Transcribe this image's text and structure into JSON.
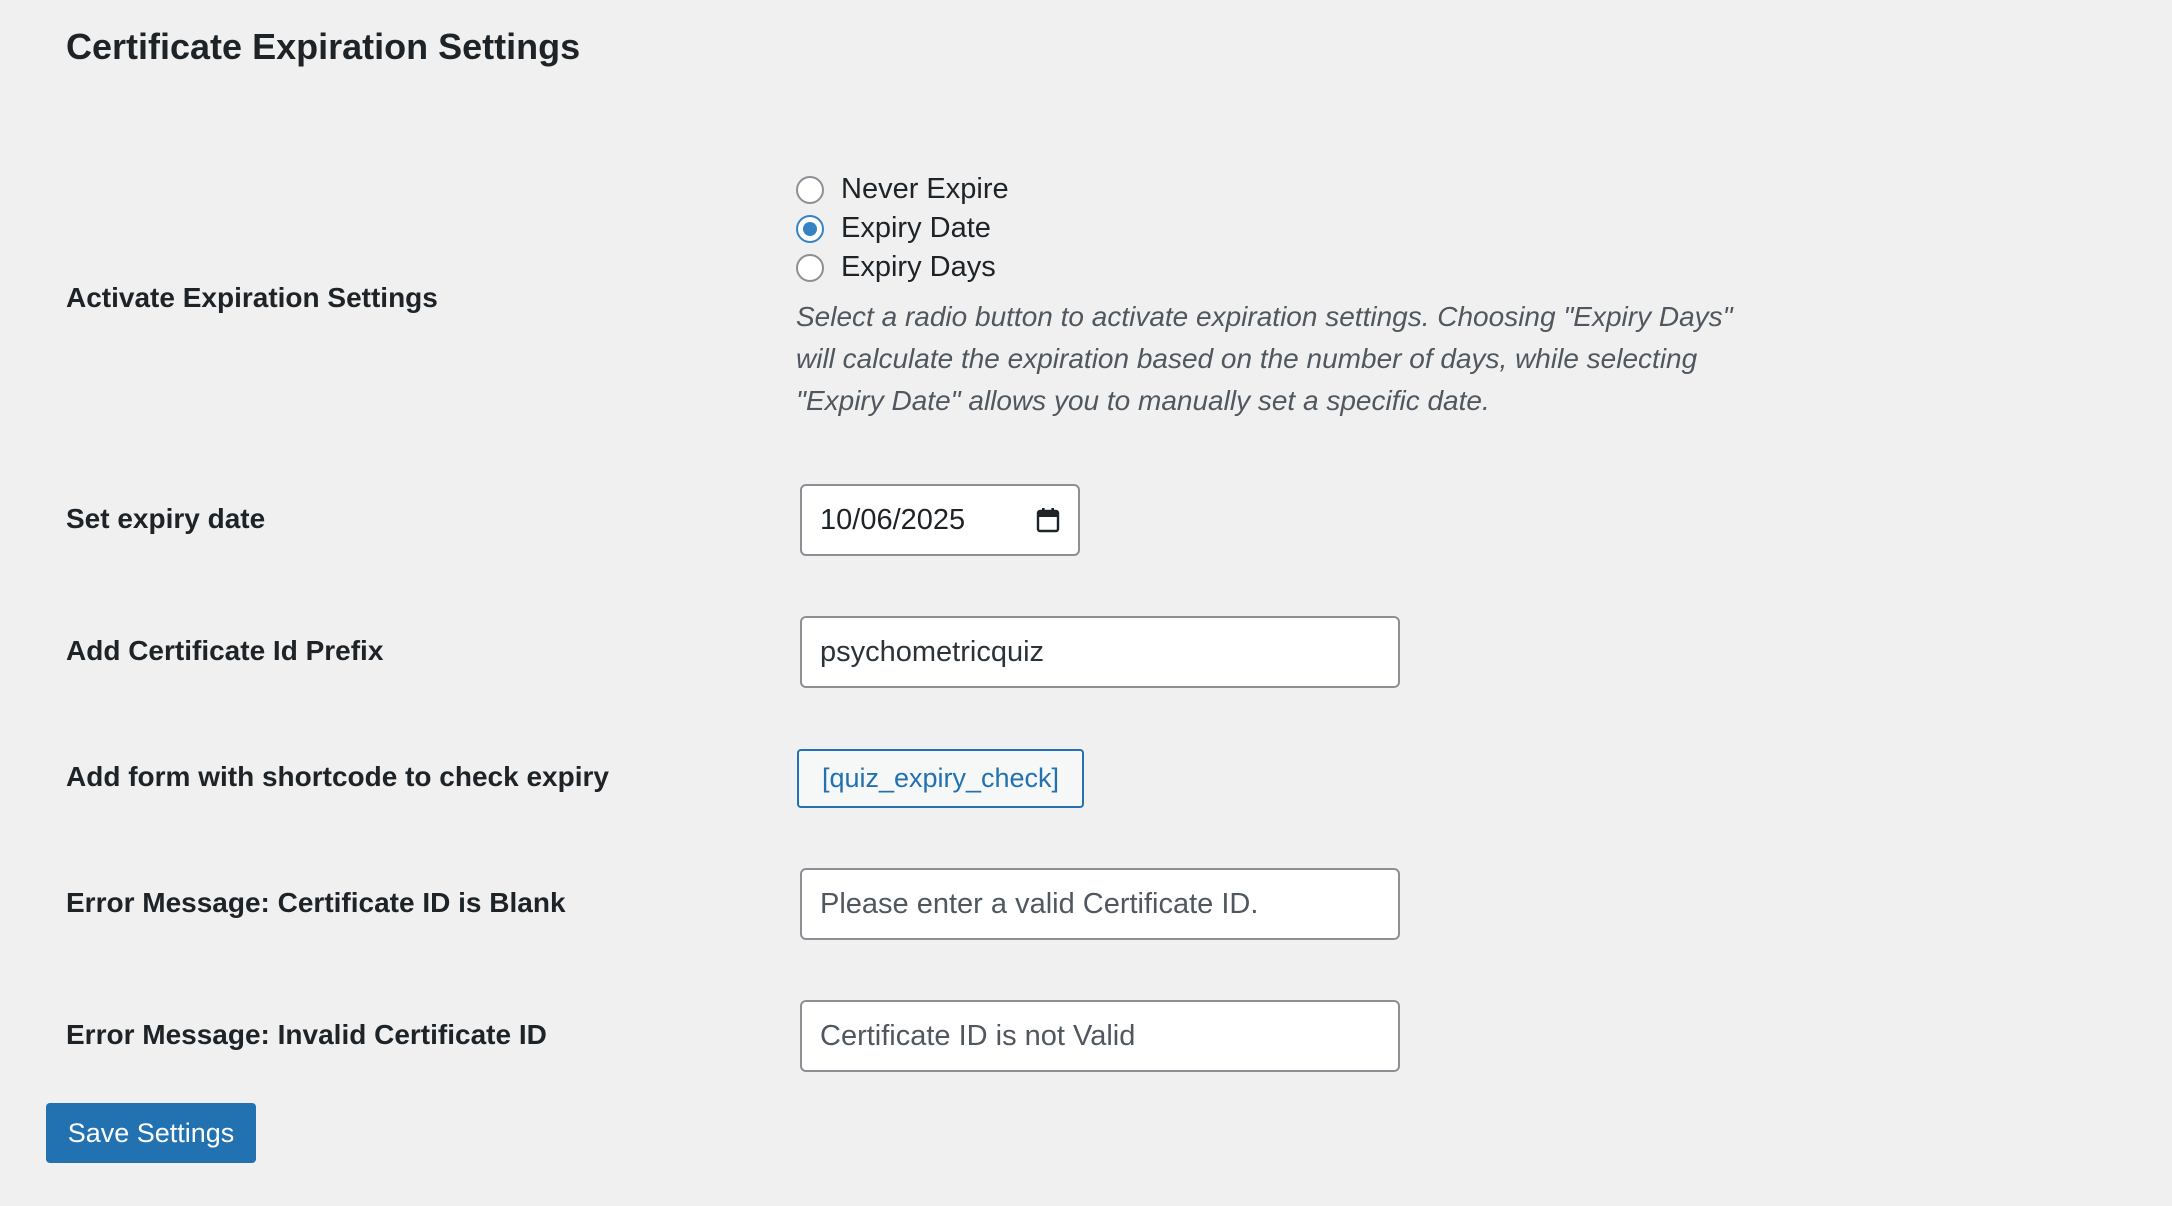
{
  "page": {
    "title": "Certificate Expiration Settings"
  },
  "expiration": {
    "label": "Activate Expiration Settings",
    "options": [
      {
        "label": "Never Expire",
        "selected": false
      },
      {
        "label": "Expiry Date",
        "selected": true
      },
      {
        "label": "Expiry Days",
        "selected": false
      }
    ],
    "description": "Select a radio button to activate expiration settings. Choosing \"Expiry Days\" will calculate the expiration based on the number of days, while selecting \"Expiry Date\" allows you to manually set a specific date."
  },
  "expiry_date": {
    "label": "Set expiry date",
    "value": "10/06/2025",
    "icon": "calendar-icon"
  },
  "prefix": {
    "label": "Add Certificate Id Prefix",
    "value": "psychometricquiz"
  },
  "shortcode": {
    "label": "Add form with shortcode to check expiry",
    "value": "[quiz_expiry_check]"
  },
  "error_blank": {
    "label": "Error Message: Certificate ID is Blank",
    "value": "Please enter a valid Certificate ID."
  },
  "error_invalid": {
    "label": "Error Message: Invalid Certificate ID",
    "value": "Certificate ID is not Valid"
  },
  "save": {
    "label": "Save Settings"
  },
  "colors": {
    "accent": "#2271b1",
    "radio_accent": "#3582c4",
    "background": "#f0f0f1"
  }
}
